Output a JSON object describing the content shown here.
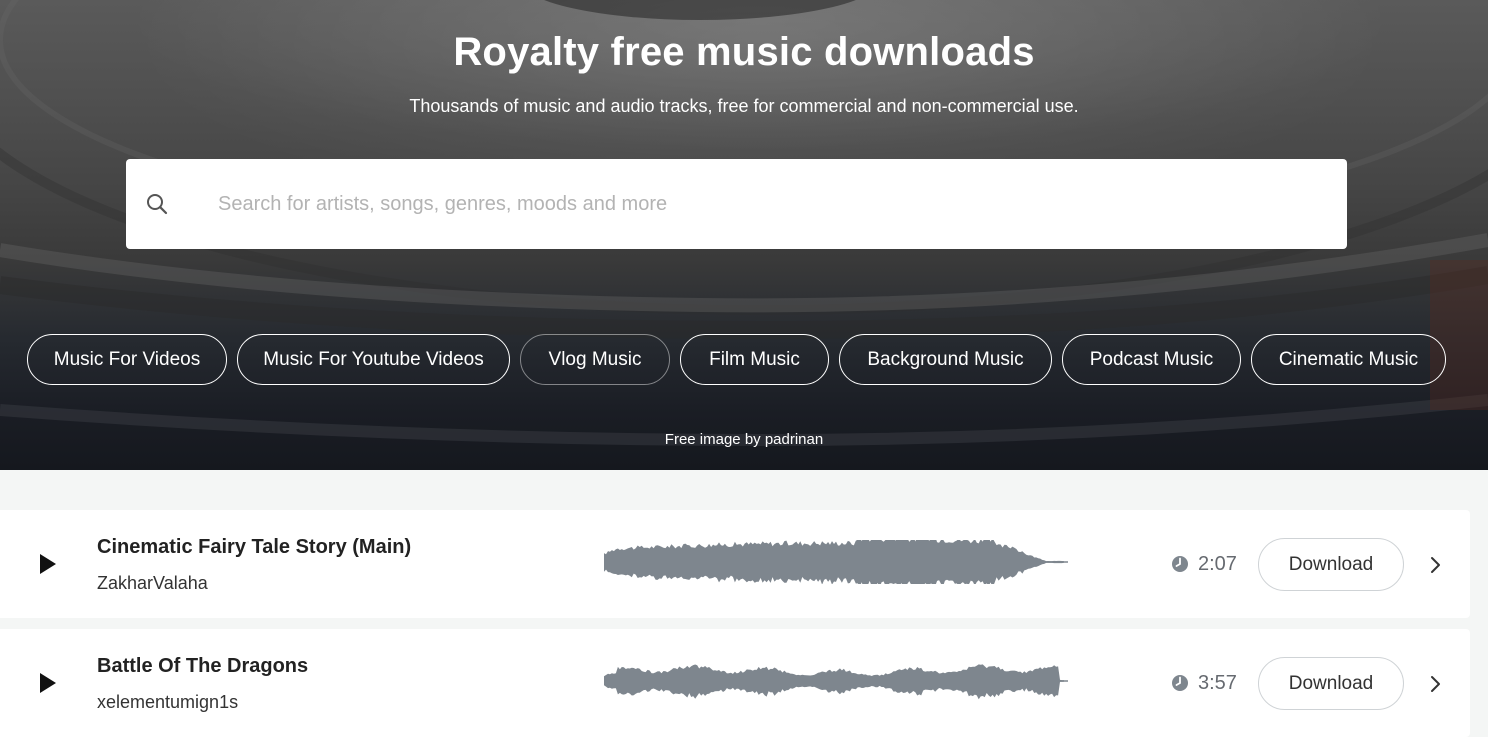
{
  "hero": {
    "title": "Royalty free music downloads",
    "subtitle": "Thousands of music and audio tracks, free for commercial and non-commercial use.",
    "search": {
      "placeholder": "Search for artists, songs, genres, moods and more",
      "value": "",
      "icon": "search-icon"
    },
    "chips": [
      {
        "label": "Music For Videos"
      },
      {
        "label": "Music For Youtube Videos"
      },
      {
        "label": "Vlog Music"
      },
      {
        "label": "Film Music"
      },
      {
        "label": "Background Music"
      },
      {
        "label": "Podcast Music"
      },
      {
        "label": "Cinematic Music"
      }
    ],
    "credit": "Free image by padrinan"
  },
  "tracks": [
    {
      "title": "Cinematic Fairy Tale Story (Main)",
      "artist": "ZakharValaha",
      "duration": "2:07",
      "download_label": "Download"
    },
    {
      "title": "Battle Of The Dragons",
      "artist": "xelementumign1s",
      "duration": "3:57",
      "download_label": "Download"
    }
  ],
  "colors": {
    "waveform": "#7e868e",
    "clock": "#7e868e",
    "page_bg": "#f4f6f5"
  }
}
